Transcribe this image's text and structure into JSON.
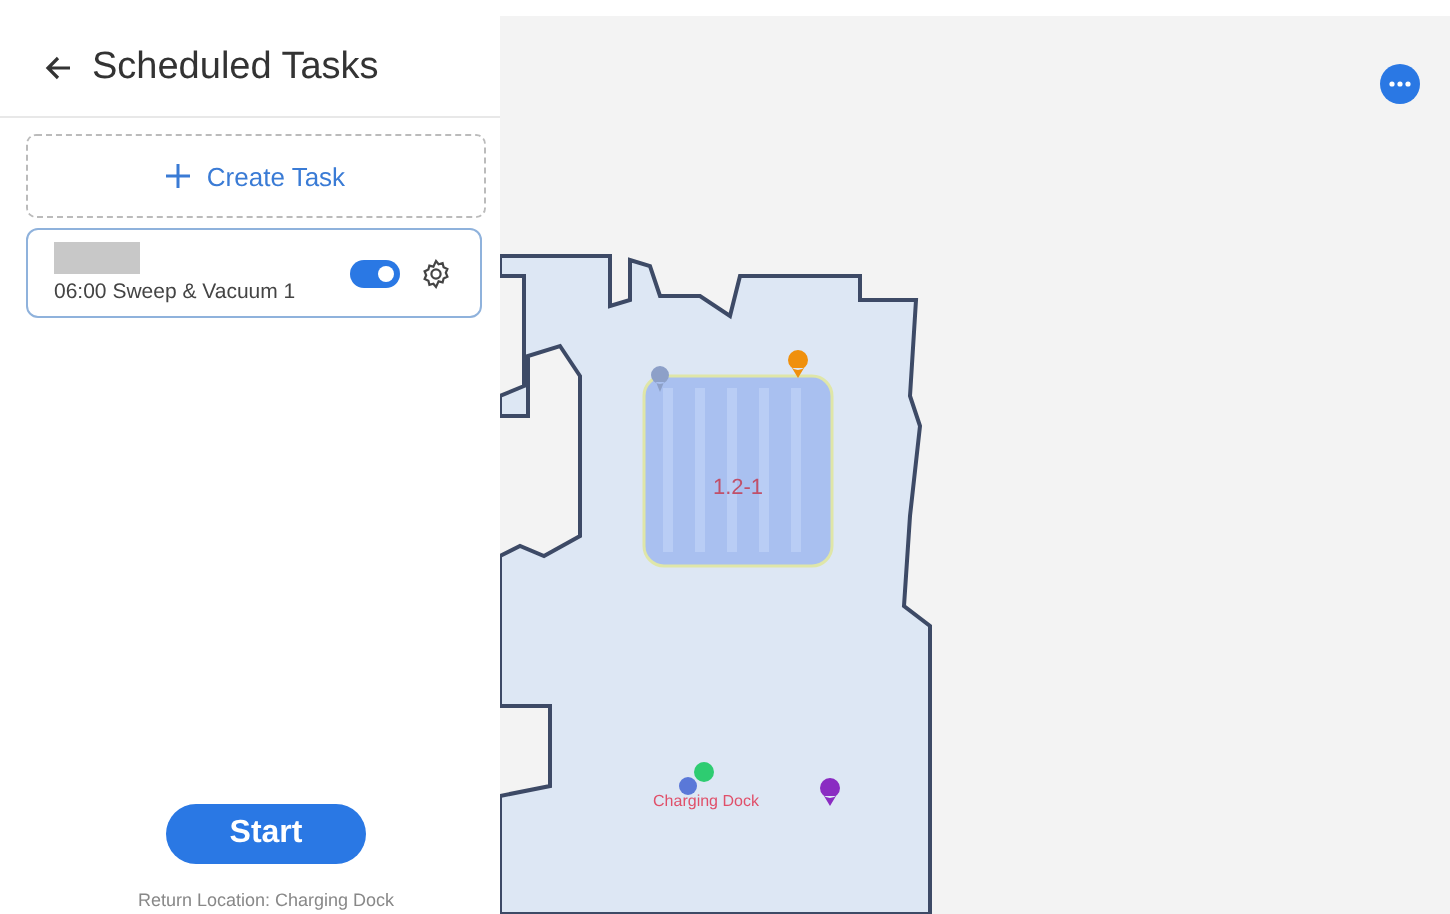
{
  "header": {
    "title": "Scheduled Tasks"
  },
  "create_button": {
    "label": "Create Task"
  },
  "tasks": [
    {
      "label": "06:00 Sweep & Vacuum 1",
      "on": true
    }
  ],
  "start_button": {
    "label": "Start"
  },
  "return_location": "Return Location: Charging Dock",
  "map": {
    "zones": [
      {
        "label": "1.2-1"
      }
    ],
    "dock_label": "Charging Dock"
  }
}
